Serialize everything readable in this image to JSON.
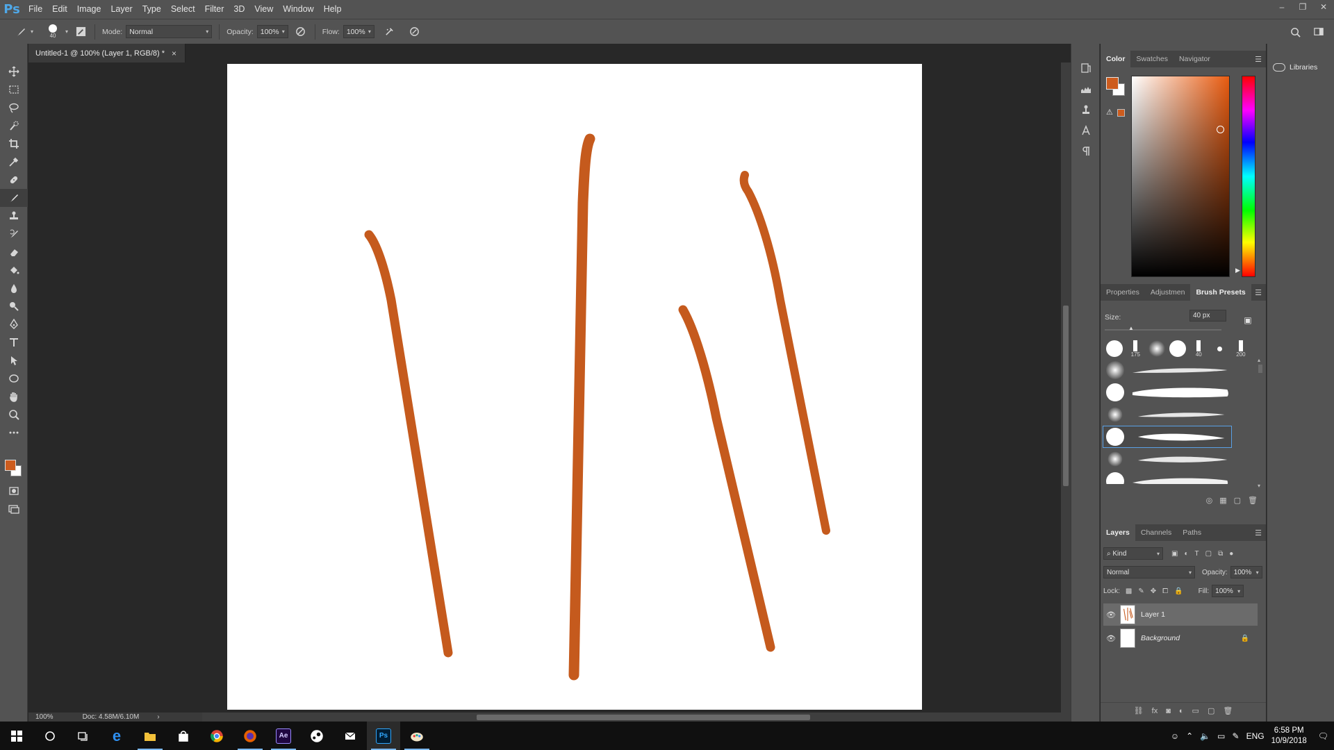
{
  "app": {
    "logo": "Ps",
    "menu": [
      "File",
      "Edit",
      "Image",
      "Layer",
      "Type",
      "Select",
      "Filter",
      "3D",
      "View",
      "Window",
      "Help"
    ],
    "window_controls": [
      "–",
      "❐",
      "✕"
    ]
  },
  "options_bar": {
    "brush_size": "40",
    "mode_label": "Mode:",
    "mode_value": "Normal",
    "opacity_label": "Opacity:",
    "opacity_value": "100%",
    "flow_label": "Flow:",
    "flow_value": "100%"
  },
  "document": {
    "tab_title": "Untitled-1 @ 100% (Layer 1, RGB/8) *",
    "close": "×",
    "zoom": "100%",
    "doc_info": "Doc: 4.58M/6.10M",
    "stroke_color": "#c55a1d",
    "canvas_bg": "#ffffff"
  },
  "color_panel": {
    "tabs": [
      "Color",
      "Swatches",
      "Navigator"
    ],
    "active_tab": "Color",
    "foreground": "#cd5c1e",
    "background": "#ffffff"
  },
  "brush_panel": {
    "tabs": [
      "Properties",
      "Adjustmen",
      "Brush Presets"
    ],
    "active_tab": "Brush Presets",
    "size_label": "Size:",
    "size_value": "40 px",
    "tip_labels": [
      "",
      "175",
      "",
      "",
      "40",
      "",
      "200"
    ]
  },
  "layers_panel": {
    "tabs": [
      "Layers",
      "Channels",
      "Paths"
    ],
    "active_tab": "Layers",
    "filter_kind": "Kind",
    "blend_mode": "Normal",
    "opacity_label": "Opacity:",
    "opacity_value": "100%",
    "lock_label": "Lock:",
    "fill_label": "Fill:",
    "fill_value": "100%",
    "layers": [
      {
        "name": "Layer 1",
        "selected": true
      },
      {
        "name": "Background",
        "selected": false,
        "locked": true
      }
    ]
  },
  "libraries": {
    "label": "Libraries"
  },
  "taskbar": {
    "apps": [
      "start-icon",
      "search-circle-icon",
      "task-view-icon",
      "edge-icon",
      "file-explorer-icon",
      "store-icon",
      "chrome-icon",
      "firefox-icon",
      "after-effects-icon",
      "steam-icon",
      "mail-icon",
      "photoshop-icon",
      "paint-icon"
    ],
    "ae_label": "Ae",
    "ps_label": "Ps",
    "lang": "ENG",
    "time": "6:58 PM",
    "date": "10/9/2018"
  }
}
